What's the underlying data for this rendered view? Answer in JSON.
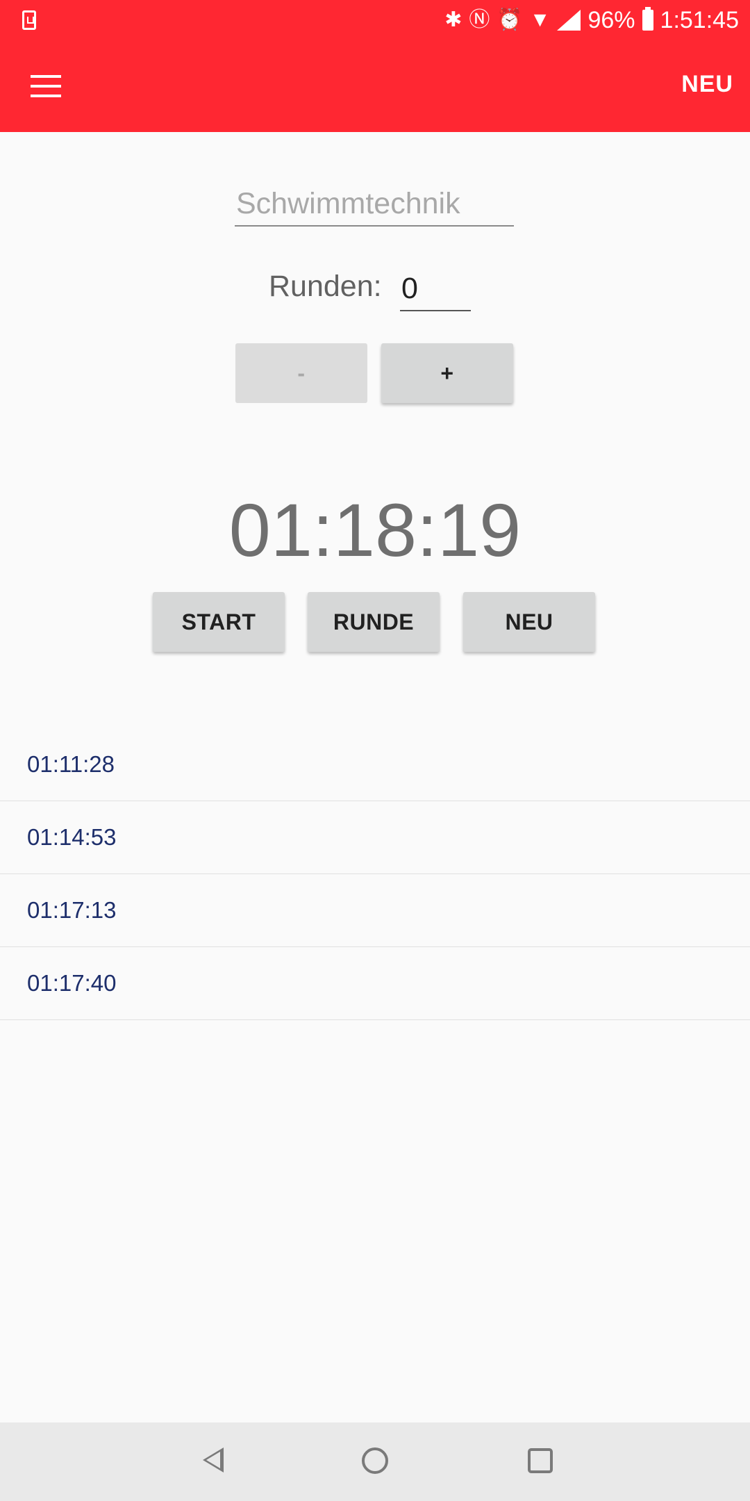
{
  "status_bar": {
    "battery": "96%",
    "time": "1:51:45",
    "icons": [
      "download-notification-icon",
      "bluetooth-icon",
      "nfc-icon",
      "alarm-icon",
      "wifi-icon",
      "cell-signal-icon",
      "battery-icon"
    ]
  },
  "app_bar": {
    "menu_icon": "hamburger-menu-icon",
    "action_label": "NEU",
    "color": "#ff2732"
  },
  "form": {
    "name_placeholder": "Schwimmtechnik",
    "rounds_label": "Runden:",
    "rounds_value": "0",
    "minus_label": "-",
    "plus_label": "+"
  },
  "timer": {
    "display": "01:18:19",
    "start_label": "START",
    "lap_label": "RUNDE",
    "reset_label": "NEU"
  },
  "laps": [
    "01:11:28",
    "01:14:53",
    "01:17:13",
    "01:17:40"
  ],
  "nav_bar": {
    "icons": [
      "back-icon",
      "home-icon",
      "recents-icon"
    ]
  }
}
